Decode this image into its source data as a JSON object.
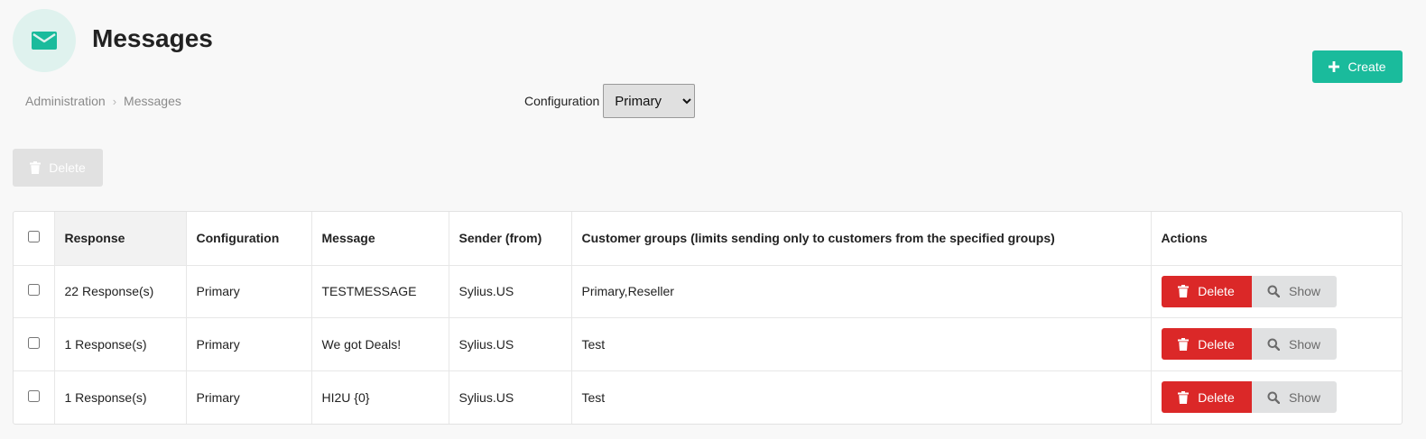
{
  "page": {
    "title": "Messages",
    "icon": "envelope-icon",
    "accent_color": "#1abb9c",
    "icon_bg": "#dff2ee"
  },
  "breadcrumb": {
    "items": [
      "Administration",
      "Messages"
    ],
    "separator": "›"
  },
  "filter": {
    "label": "Configuration",
    "selected": "Primary",
    "options": [
      "Primary"
    ]
  },
  "toolbar": {
    "create_label": "Create",
    "bulk_delete_label": "Delete"
  },
  "table": {
    "headers": [
      "Response",
      "Configuration",
      "Message",
      "Sender (from)",
      "Customer groups (limits sending only to customers from the specified groups)",
      "Actions"
    ],
    "rows": [
      {
        "response": "22 Response(s)",
        "configuration": "Primary",
        "message": "TESTMESSAGE",
        "sender": "Sylius.US",
        "groups": "Primary,Reseller"
      },
      {
        "response": "1 Response(s)",
        "configuration": "Primary",
        "message": "We got Deals!",
        "sender": "Sylius.US",
        "groups": "Test"
      },
      {
        "response": "1 Response(s)",
        "configuration": "Primary",
        "message": "HI2U {0}",
        "sender": "Sylius.US",
        "groups": "Test"
      }
    ],
    "actions": {
      "delete_label": "Delete",
      "show_label": "Show",
      "delete_color": "#db2828",
      "show_color": "#e0e1e2"
    }
  }
}
